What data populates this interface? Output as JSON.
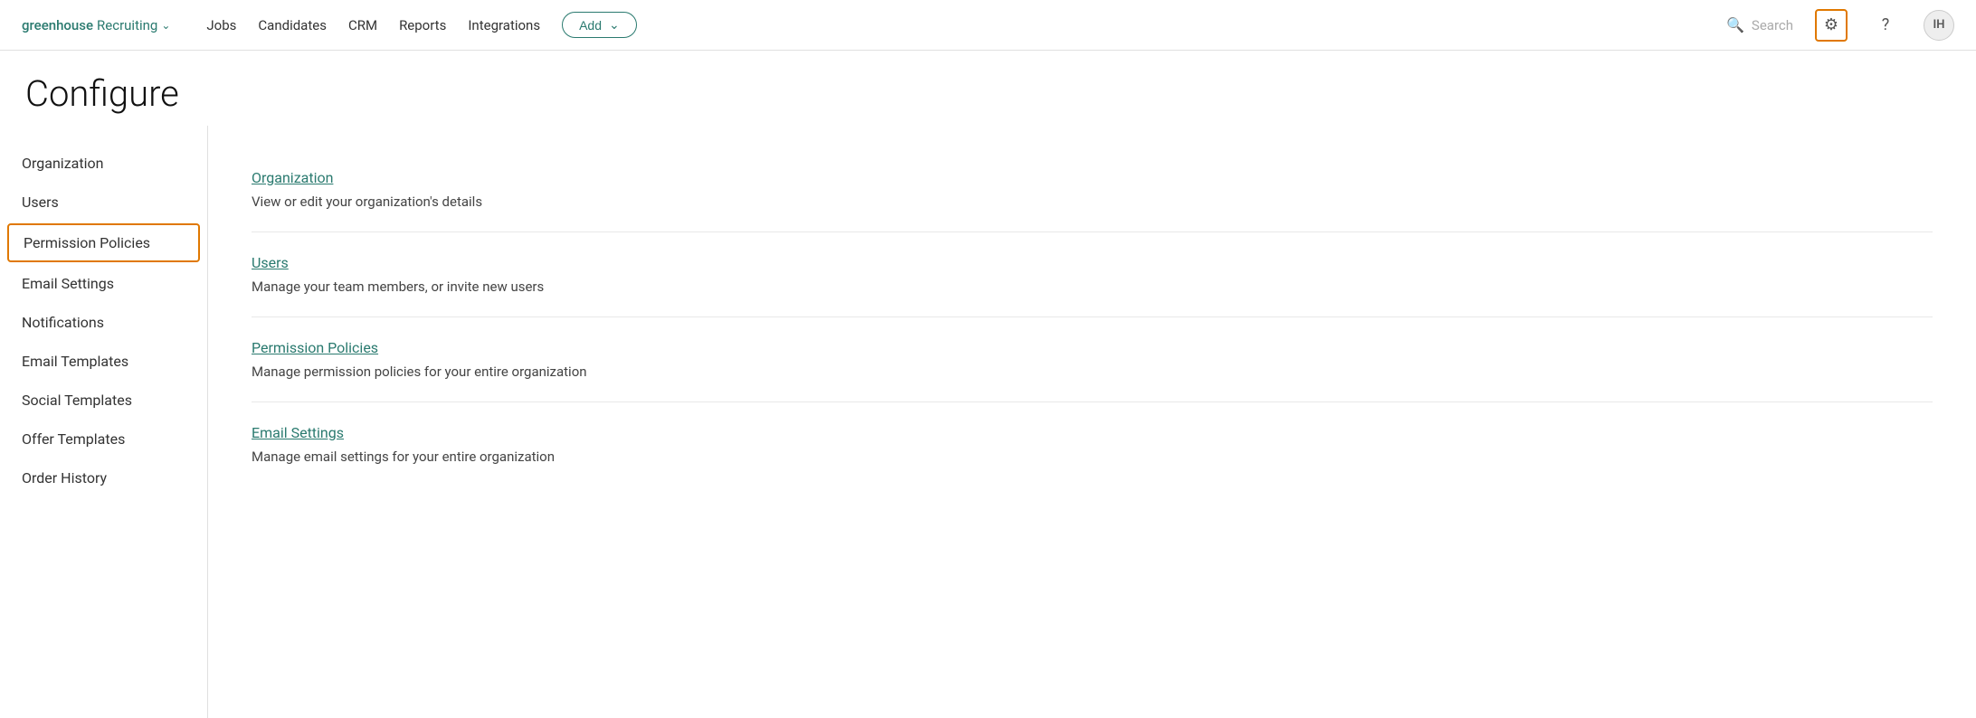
{
  "brand": {
    "logo": "greenhouse",
    "sub": "Recruiting"
  },
  "nav": {
    "items": [
      "Jobs",
      "Candidates",
      "CRM",
      "Reports",
      "Integrations"
    ],
    "add_label": "Add"
  },
  "search": {
    "placeholder": "Search"
  },
  "header": {
    "title": "Configure"
  },
  "sidebar": {
    "items": [
      {
        "label": "Organization",
        "active": false
      },
      {
        "label": "Users",
        "active": false
      },
      {
        "label": "Permission Policies",
        "active": true
      },
      {
        "label": "Email Settings",
        "active": false
      },
      {
        "label": "Notifications",
        "active": false
      },
      {
        "label": "Email Templates",
        "active": false
      },
      {
        "label": "Social Templates",
        "active": false
      },
      {
        "label": "Offer Templates",
        "active": false
      },
      {
        "label": "Order History",
        "active": false
      }
    ]
  },
  "sections": [
    {
      "link": "Organization",
      "desc": "View or edit your organization's details"
    },
    {
      "link": "Users",
      "desc": "Manage your team members, or invite new users"
    },
    {
      "link": "Permission Policies",
      "desc": "Manage permission policies for your entire organization"
    },
    {
      "link": "Email Settings",
      "desc": "Manage email settings for your entire organization"
    }
  ],
  "icons": {
    "gear": "⚙",
    "help": "?",
    "avatar": "IH",
    "search": "🔍",
    "chevron": "∨"
  }
}
